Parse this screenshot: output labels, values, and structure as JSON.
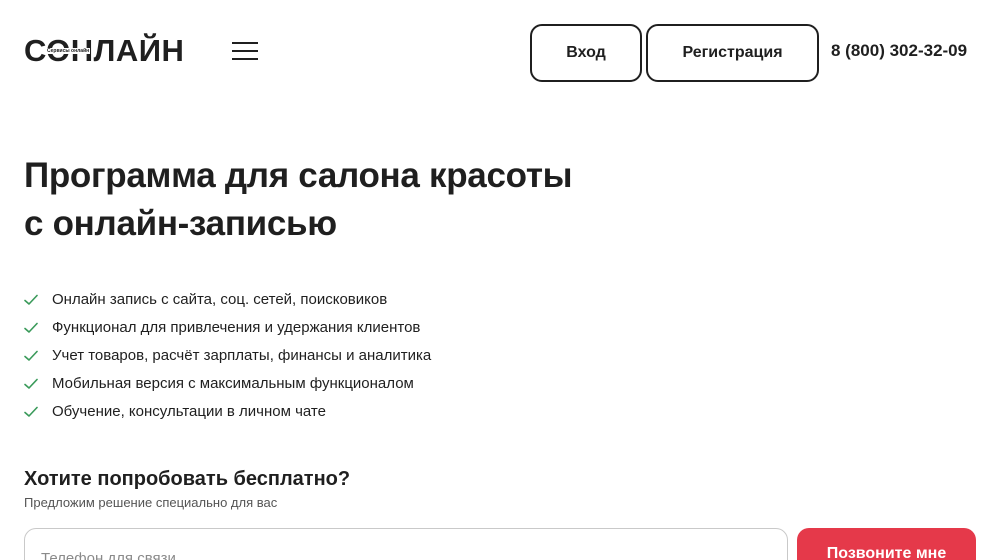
{
  "header": {
    "logo_text": "СОНЛАЙН",
    "logo_tagline": "Сервисы онлайн",
    "menu_icon": "hamburger-menu-icon",
    "login_label": "Вход",
    "register_label": "Регистрация",
    "phone": "8 (800) 302-32-09"
  },
  "hero": {
    "title_line1": "Программа для салона красоты",
    "title_line2": "с онлайн-записью",
    "check_icon": "check-icon",
    "check_color": "#3a9a5a",
    "features": [
      "Онлайн запись с сайта, соц. сетей, поисковиков",
      "Функционал для привлечения и удержания клиентов",
      "Учет товаров, расчёт зарплаты, финансы и аналитика",
      "Мобильная версия с максимальным функционалом",
      "Обучение, консультации в личном чате"
    ]
  },
  "cta": {
    "title": "Хотите попробовать бесплатно?",
    "subtitle": "Предложим решение специально для вас",
    "phone_placeholder": "Телефон для связи",
    "phone_value": "",
    "button_label": "Позвоните мне",
    "button_color": "#e5394a"
  }
}
